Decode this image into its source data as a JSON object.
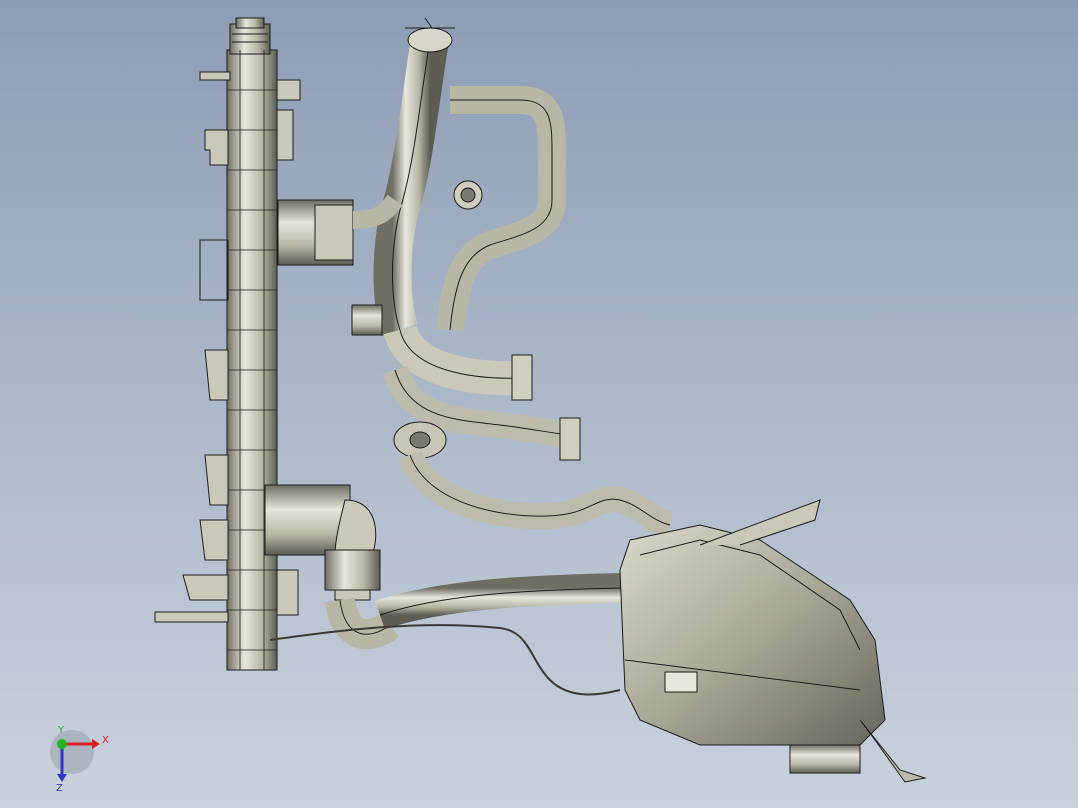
{
  "viewport": {
    "background_top": "#8c9cb3",
    "background_bottom": "#c9d1dc"
  },
  "model": {
    "metal_light": "#e6e6dc",
    "metal_mid": "#b8b7a6",
    "metal_dark": "#6f6e63",
    "edge_color": "#1c1c1c"
  },
  "triad": {
    "x_label": "X",
    "y_label": "Y",
    "z_label": "Z",
    "x_color": "#d62020",
    "y_color": "#1fb51f",
    "z_color": "#2838c8"
  }
}
